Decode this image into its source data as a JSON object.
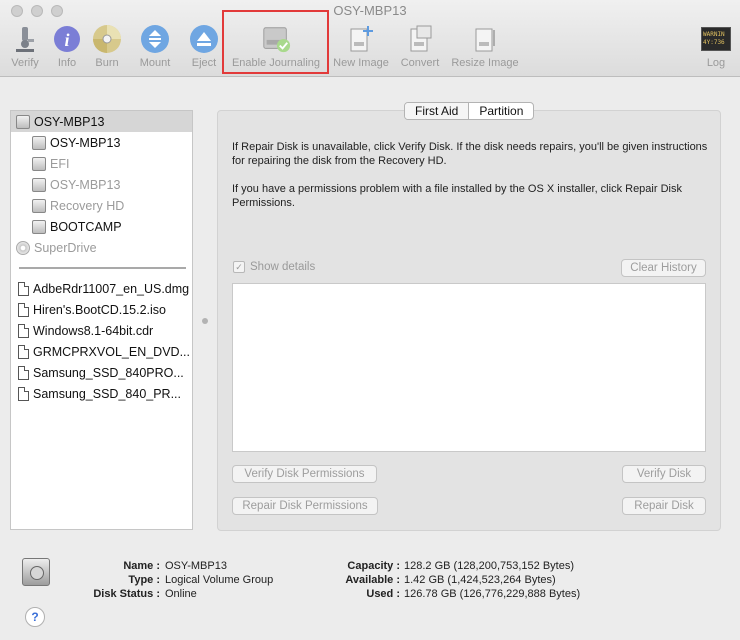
{
  "window": {
    "title": "OSY-MBP13"
  },
  "toolbar": {
    "items": [
      {
        "label": "Verify",
        "icon": "microscope-icon"
      },
      {
        "label": "Info",
        "icon": "info-icon"
      },
      {
        "label": "Burn",
        "icon": "burn-icon"
      },
      {
        "label": "Mount",
        "icon": "mount-icon"
      },
      {
        "label": "Eject",
        "icon": "eject-icon"
      },
      {
        "label": "Enable Journaling",
        "icon": "journaling-disk-icon"
      },
      {
        "label": "New Image",
        "icon": "new-image-icon"
      },
      {
        "label": "Convert",
        "icon": "convert-icon"
      },
      {
        "label": "Resize Image",
        "icon": "resize-image-icon"
      },
      {
        "label": "Log",
        "icon": "log-console-icon"
      }
    ],
    "log_badge_line1": "WARNIN",
    "log_badge_line2": "4Y:736"
  },
  "sidebar": {
    "devices": [
      {
        "label": "OSY-MBP13",
        "selected": true
      },
      {
        "label": "OSY-MBP13"
      },
      {
        "label": "EFI",
        "dim": true
      },
      {
        "label": "OSY-MBP13",
        "dim": true
      },
      {
        "label": "Recovery HD",
        "dim": true
      },
      {
        "label": "BOOTCAMP"
      },
      {
        "label": "SuperDrive",
        "dim": true
      }
    ],
    "images": [
      {
        "label": "AdbeRdr11007_en_US.dmg"
      },
      {
        "label": "Hiren's.BootCD.15.2.iso"
      },
      {
        "label": "Windows8.1-64bit.cdr"
      },
      {
        "label": "GRMCPRXVOL_EN_DVD..."
      },
      {
        "label": "Samsung_SSD_840PRO..."
      },
      {
        "label": "Samsung_SSD_840_PR..."
      }
    ]
  },
  "tabs": {
    "first_aid": "First Aid",
    "partition": "Partition"
  },
  "first_aid": {
    "para1": "If Repair Disk is unavailable, click Verify Disk. If the disk needs repairs, you'll be given instructions for repairing the disk from the Recovery HD.",
    "para2": "If you have a permissions problem with a file installed by the OS X installer, click Repair Disk Permissions.",
    "show_details": "Show details",
    "show_details_checked": true,
    "clear_history": "Clear History",
    "verify_permissions": "Verify Disk Permissions",
    "verify_disk": "Verify Disk",
    "repair_permissions": "Repair Disk Permissions",
    "repair_disk": "Repair Disk"
  },
  "info": {
    "name_key": "Name :",
    "name_val": "OSY-MBP13",
    "type_key": "Type :",
    "type_val": "Logical Volume Group",
    "status_key": "Disk Status :",
    "status_val": "Online",
    "capacity_key": "Capacity :",
    "capacity_val": "128.2 GB (128,200,753,152 Bytes)",
    "available_key": "Available :",
    "available_val": "1.42 GB (1,424,523,264 Bytes)",
    "used_key": "Used :",
    "used_val": "126.78 GB (126,776,229,888 Bytes)",
    "help": "?"
  }
}
